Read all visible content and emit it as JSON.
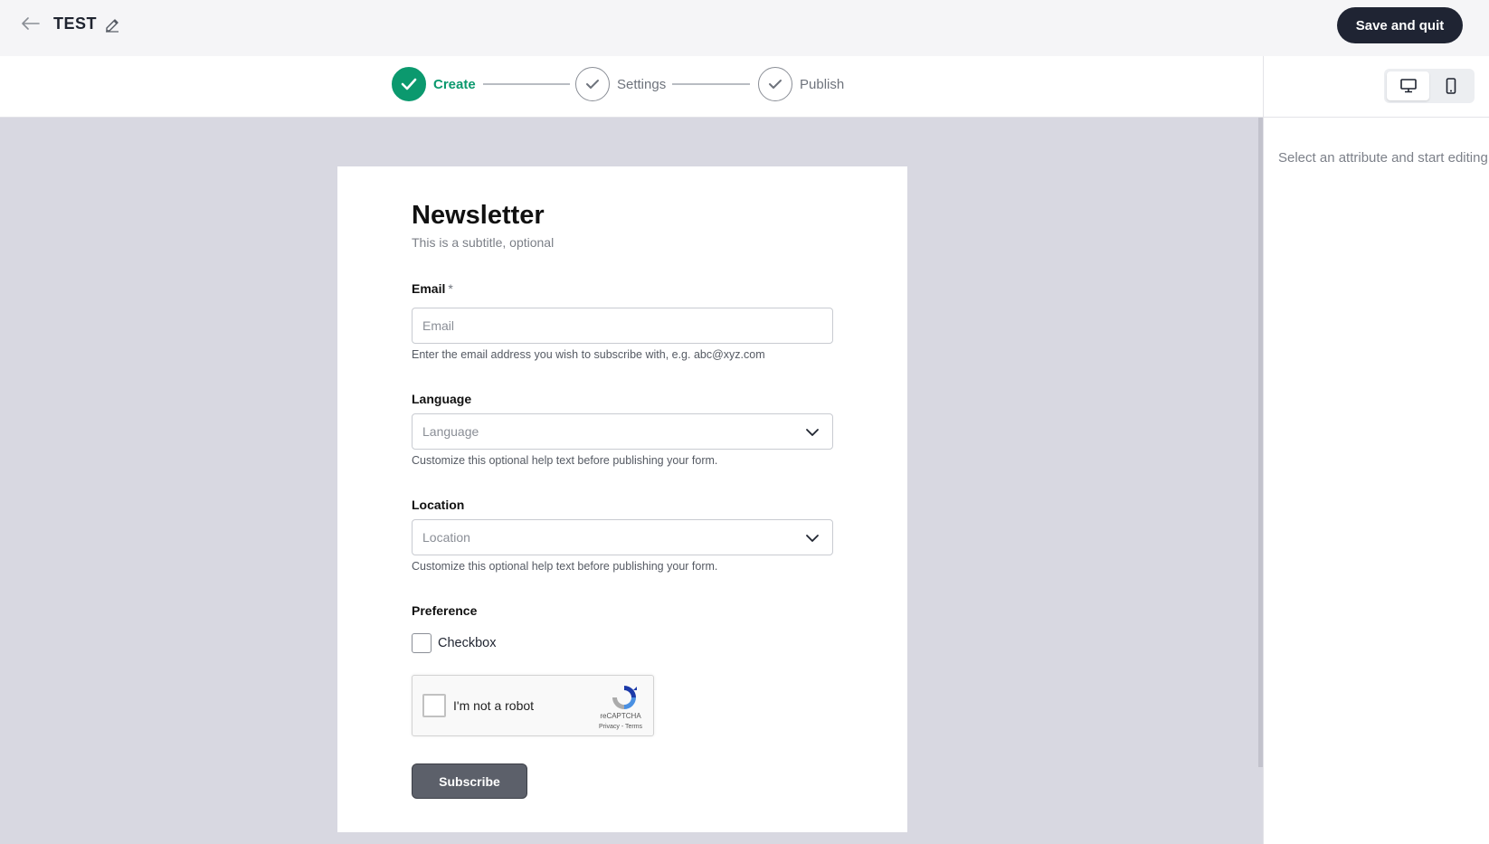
{
  "header": {
    "form_title": "TEST",
    "save_label": "Save and quit",
    "back_icon": "arrow-left-icon",
    "edit_icon": "pencil-icon"
  },
  "steps": [
    {
      "label": "Create",
      "state": "active"
    },
    {
      "label": "Settings",
      "state": "pending"
    },
    {
      "label": "Publish",
      "state": "pending"
    }
  ],
  "right_panel": {
    "hint": "Select an attribute and start editing",
    "devices": [
      "desktop",
      "mobile"
    ],
    "selected_device": "desktop"
  },
  "form": {
    "title": "Newsletter",
    "subtitle": "This is a subtitle, optional",
    "email": {
      "label": "Email",
      "required_mark": "*",
      "placeholder": "Email",
      "help": "Enter the email address you wish to subscribe with, e.g. abc@xyz.com"
    },
    "language": {
      "label": "Language",
      "placeholder": "Language",
      "help": "Customize this optional help text before publishing your form."
    },
    "location": {
      "label": "Location",
      "placeholder": "Location",
      "help": "Customize this optional help text before publishing your form."
    },
    "preference": {
      "label": "Preference",
      "checkbox_label": "Checkbox",
      "checked": false
    },
    "recaptcha": {
      "label": "I'm not a robot",
      "brand": "reCAPTCHA",
      "links": "Privacy - Terms"
    },
    "submit_label": "Subscribe"
  },
  "colors": {
    "accent": "#0b996e",
    "dark_button": "#1f2433",
    "canvas_bg": "#d8d8e1",
    "submit_bg": "#5c606a"
  }
}
